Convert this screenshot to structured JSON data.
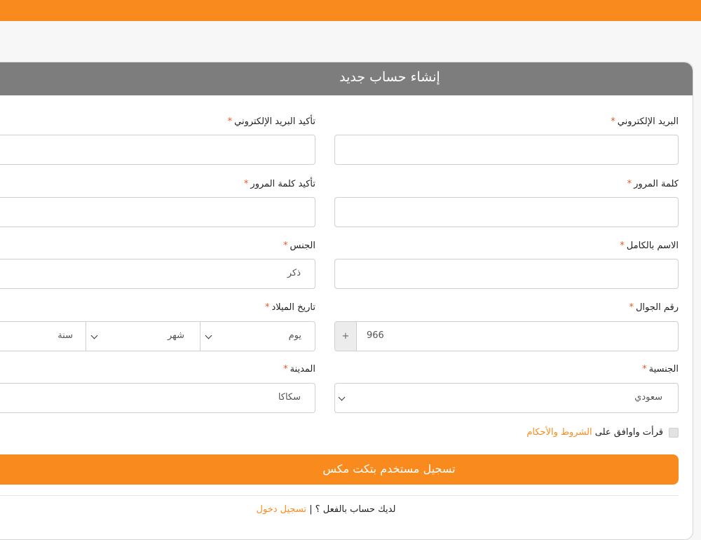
{
  "form": {
    "title": "إنشاء حساب جديد",
    "required_mark": "*",
    "email": {
      "label": "البريد الإلكتروني",
      "value": ""
    },
    "email_confirm": {
      "label": "تأكيد البريد الإلكتروني",
      "value": ""
    },
    "password": {
      "label": "كلمة المرور",
      "value": ""
    },
    "password_confirm": {
      "label": "تأكيد كلمة المرور",
      "value": ""
    },
    "full_name": {
      "label": "الاسم بالكامل",
      "value": ""
    },
    "gender": {
      "label": "الجنس",
      "value": "ذكر"
    },
    "mobile": {
      "label": "رقم الجوال",
      "prefix": "+",
      "value": "966"
    },
    "birthdate": {
      "label": "تاريخ الميلاد",
      "day": "يوم",
      "month": "شهر",
      "year": "سنة"
    },
    "nationality": {
      "label": "الجنسية",
      "value": "سعودي"
    },
    "city": {
      "label": "المدينة",
      "value": "سكاكا"
    },
    "terms": {
      "text": "قرأت واوافق على",
      "link": "الشروط والأحكام"
    },
    "submit_label": "تسجيل مستخدم بتكت مكس",
    "login_prompt": "لديك حساب بالفعل ؟",
    "login_separator": "|",
    "login_link": "تسجيل دخول"
  },
  "colors": {
    "accent": "#f98b1e",
    "header": "#7d7d7d",
    "required": "#e8572a"
  }
}
